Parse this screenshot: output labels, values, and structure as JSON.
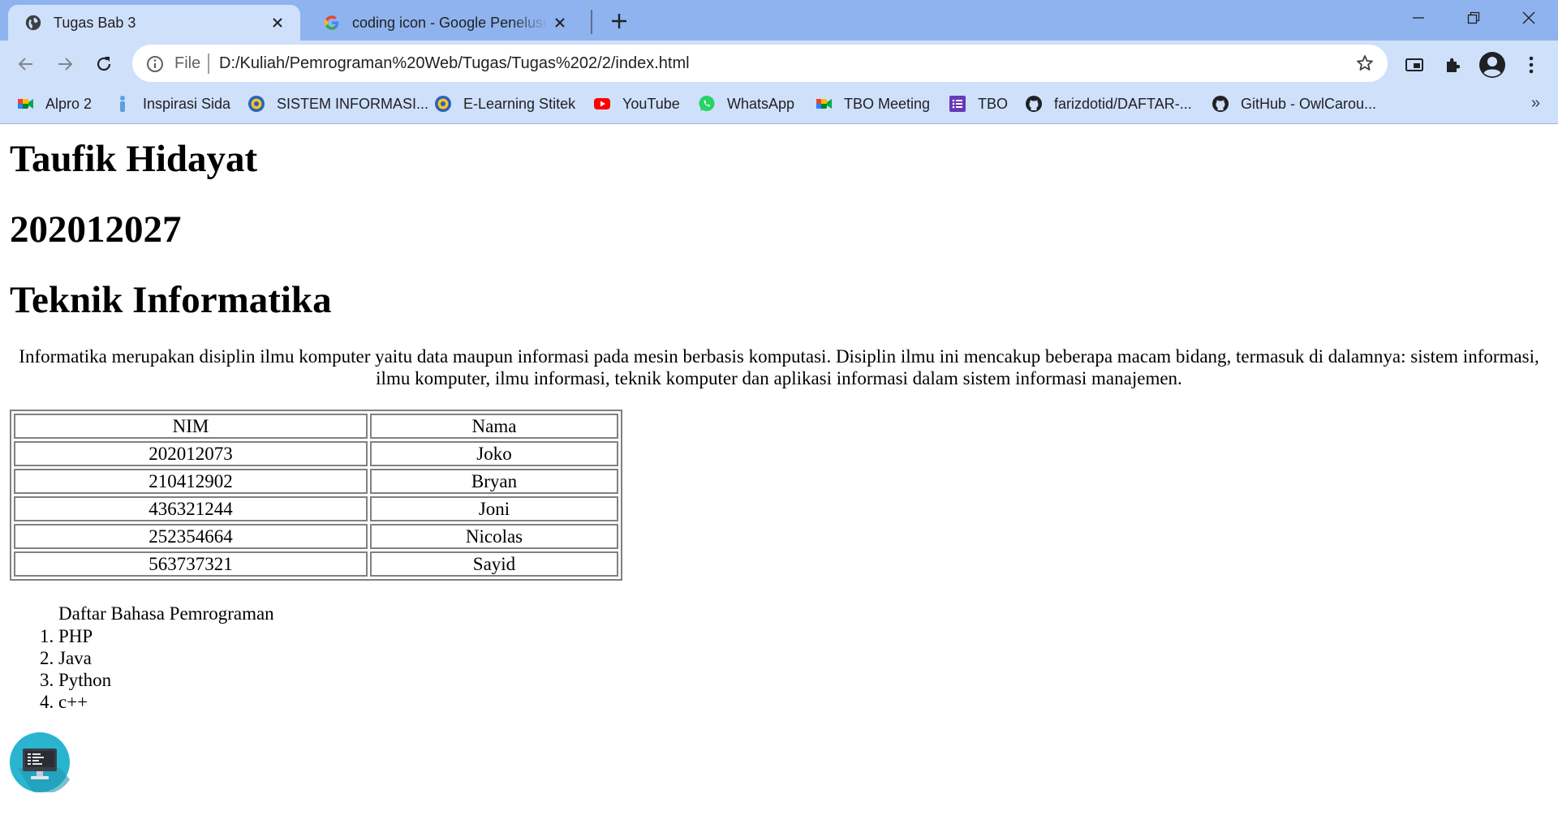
{
  "browser": {
    "tabs": [
      {
        "title": "Tugas Bab 3",
        "icon": "globe-icon",
        "active": true
      },
      {
        "title": "coding icon - Google Penelusuran",
        "icon": "google-icon",
        "active": false
      }
    ],
    "address": {
      "scheme": "File",
      "url": "D:/Kuliah/Pemrograman%20Web/Tugas/Tugas%202/2/index.html"
    },
    "bookmarks": [
      {
        "label": "Alpro 2",
        "icon": "google-meet-icon"
      },
      {
        "label": "Inspirasi Sida",
        "icon": "person-icon"
      },
      {
        "label": "SISTEM INFORMASI...",
        "icon": "university-logo-icon"
      },
      {
        "label": "E-Learning Stitek",
        "icon": "university-logo-icon"
      },
      {
        "label": "YouTube",
        "icon": "youtube-icon"
      },
      {
        "label": "WhatsApp",
        "icon": "whatsapp-icon"
      },
      {
        "label": "TBO Meeting",
        "icon": "google-meet-icon"
      },
      {
        "label": "TBO",
        "icon": "google-forms-icon"
      },
      {
        "label": "farizdotid/DAFTAR-...",
        "icon": "github-icon"
      },
      {
        "label": "GitHub - OwlCarou...",
        "icon": "github-icon"
      }
    ],
    "bookmarks_more": "»"
  },
  "page": {
    "headings": [
      "Taufik Hidayat",
      "202012027",
      "Teknik Informatika"
    ],
    "paragraph": "Informatika merupakan disiplin ilmu komputer yaitu data maupun informasi pada mesin berbasis komputasi. Disiplin ilmu ini mencakup beberapa macam bidang, termasuk di dalamnya: sistem informasi, ilmu komputer, ilmu informasi, teknik komputer dan aplikasi informasi dalam sistem informasi manajemen.",
    "table": {
      "headers": [
        "NIM",
        "Nama"
      ],
      "rows": [
        [
          "202012073",
          "Joko"
        ],
        [
          "210412902",
          "Bryan"
        ],
        [
          "436321244",
          "Joni"
        ],
        [
          "252354664",
          "Nicolas"
        ],
        [
          "563737321",
          "Sayid"
        ]
      ]
    },
    "list": {
      "heading": "Daftar Bahasa Pemrograman",
      "items": [
        "PHP",
        "Java",
        "Python",
        "c++"
      ]
    },
    "image_icon": "computer-monitor-code-icon"
  }
}
